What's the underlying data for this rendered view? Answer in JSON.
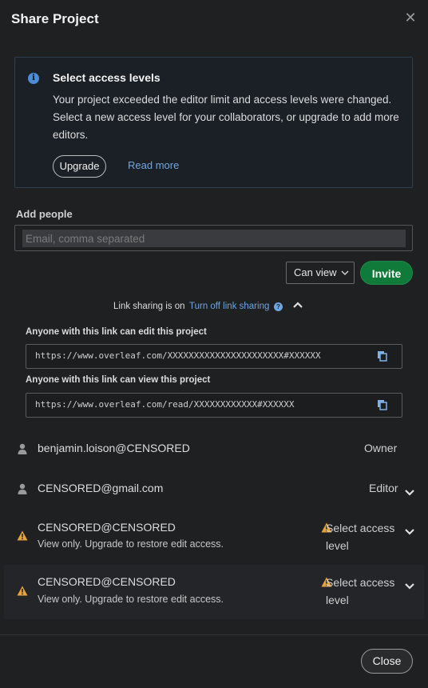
{
  "modal": {
    "title": "Share Project"
  },
  "alert": {
    "title": "Select access levels",
    "body": "Your project exceeded the editor limit and access levels were changed. Select a new access level for your collaborators, or upgrade to add more editors.",
    "upgrade_label": "Upgrade",
    "read_more_label": "Read more"
  },
  "add_people": {
    "label": "Add people",
    "placeholder": "Email, comma separated",
    "permission_selected": "Can view",
    "invite_label": "Invite"
  },
  "link_sharing": {
    "status_label": "Link sharing is on",
    "toggle_label": "Turn off link sharing",
    "edit_label": "Anyone with this link can edit this project",
    "edit_url": "https://www.overleaf.com/XXXXXXXXXXXXXXXXXXXXXX#XXXXXX",
    "view_label": "Anyone with this link can view this project",
    "view_url": "https://www.overleaf.com/read/XXXXXXXXXXXX#XXXXXX"
  },
  "members": [
    {
      "email": "benjamin.loison@CENSORED",
      "role": "Owner"
    },
    {
      "email": "CENSORED@gmail.com",
      "role": "Editor"
    },
    {
      "email": "CENSORED@CENSORED",
      "note": "View only. Upgrade to restore edit access.",
      "role": "Select access level"
    },
    {
      "email": "CENSORED@CENSORED",
      "note": "View only. Upgrade to restore edit access.",
      "role": "Select access level"
    }
  ],
  "footer": {
    "close_label": "Close"
  },
  "colors": {
    "accent_green": "#0f7a3a",
    "link_blue": "#6fa5e0",
    "warning": "#e8a23a",
    "info": "#4d8dd6"
  }
}
